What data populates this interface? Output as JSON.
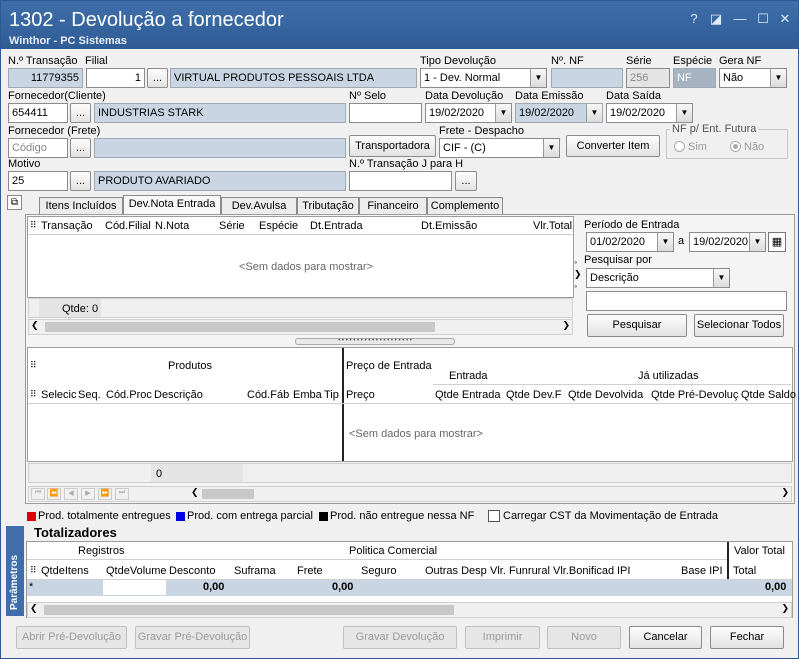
{
  "window": {
    "title": "1302 - Devolução a fornecedor",
    "subtitle": "Winthor - PC Sistemas"
  },
  "header": {
    "labels": {
      "transacao": "N.º Transação",
      "filial": "Filial",
      "tipo_devolucao": "Tipo Devolução",
      "num_nf": "Nº. NF",
      "serie": "Série",
      "especie": "Espécie",
      "gera_nf": "Gera NF",
      "fornecedor_cliente": "Fornecedor(Cliente)",
      "num_selo": "Nº Selo",
      "data_devolucao": "Data Devolução",
      "data_emissao": "Data Emissão",
      "data_saida": "Data Saída",
      "fornecedor_frete": "Fornecedor (Frete)",
      "frete_despacho": "Frete - Despacho",
      "nf_futura": "NF p/ Ent. Futura",
      "motivo": "Motivo",
      "transacao_j": "N.º Transação J para H"
    },
    "values": {
      "transacao": "11779355",
      "filial": "1",
      "filial_nome": "VIRTUAL PRODUTOS PESSOAIS LTDA",
      "tipo_devolucao": "1 - Dev. Normal",
      "num_nf": "",
      "serie": "256",
      "especie": "NF",
      "gera_nf": "Não",
      "fornecedor_codigo": "654411",
      "fornecedor_nome": "INDUSTRIAS STARK",
      "num_selo": "",
      "data_devolucao": "19/02/2020",
      "data_emissao": "19/02/2020",
      "data_saida": "19/02/2020",
      "fornecedor_frete_placeholder": "Código",
      "frete_despacho": "CIF - (C)",
      "radio_sim": "Sim",
      "radio_nao": "Não",
      "motivo_codigo": "25",
      "motivo_nome": "PRODUTO AVARIADO",
      "transacao_j": ""
    },
    "buttons": {
      "ellipsis": "...",
      "transportadora": "Transportadora",
      "converter_item": "Converter Item"
    }
  },
  "tabs": [
    {
      "label": "Itens Incluídos"
    },
    {
      "label": "Dev.Nota Entrada"
    },
    {
      "label": "Dev.Avulsa"
    },
    {
      "label": "Tributação"
    },
    {
      "label": "Financeiro"
    },
    {
      "label": "Complemento"
    }
  ],
  "notes_grid": {
    "columns": [
      "Transação",
      "Cód.Filial",
      "N.Nota",
      "Série",
      "Espécie",
      "Dt.Entrada",
      "Dt.Emissão",
      "Vlr.Total"
    ],
    "empty_text": "<Sem dados para mostrar>",
    "qtde_label": "Qtde: 0"
  },
  "search_panel": {
    "periodo_label": "Período de Entrada",
    "data_inicio": "01/02/2020",
    "a_label": "a",
    "data_fim": "19/02/2020",
    "pesquisar_por_label": "Pesquisar por",
    "pesquisar_por_value": "Descrição",
    "search_text": "",
    "pesquisar_button": "Pesquisar",
    "selecionar_todos_button": "Selecionar Todos"
  },
  "products_grid": {
    "group_headers": {
      "produtos": "Produtos",
      "preco_entrada": "Preço de Entrada",
      "entrada": "Entrada",
      "ja_utilizadas": "Já utilizadas"
    },
    "columns": [
      "Selecic",
      "Seq.",
      "Cód.Proc",
      "Descrição",
      "Cód.Fáb",
      "Emba",
      "Tip",
      "Preço",
      "Qtde Entrada",
      "Qtde Dev.F",
      "Qtde Devolvida",
      "Qtde Pré-Devoluç",
      "Qtde Saldo"
    ],
    "empty_text": "<Sem dados para mostrar>",
    "footer_count": "0"
  },
  "legend": {
    "items": [
      {
        "color": "#e00000",
        "label": "Prod. totalmente entregues"
      },
      {
        "color": "#0000e0",
        "label": "Prod. com entrega parcial"
      },
      {
        "color": "#000000",
        "label": "Prod. não entregue nessa NF"
      }
    ],
    "checkbox_label": "Carregar CST da Movimentação de Entrada"
  },
  "totalizadores": {
    "title": "Totalizadores",
    "side_label": "Parâmetros",
    "group_headers": {
      "registros": "Registros",
      "politica": "Politica Comercial",
      "valor_total": "Valor Total"
    },
    "columns": [
      "QtdeItens",
      "QtdeVolume",
      "Desconto",
      "Suframa",
      "Frete",
      "Seguro",
      "Outras Desp",
      "Vlr. Funrural",
      "Vlr.Bonificad",
      "IPI",
      "Base IPI",
      "Total"
    ],
    "row_marker": "*",
    "values": {
      "desconto": "0,00",
      "frete": "0,00",
      "total": "0,00"
    }
  },
  "footer_buttons": {
    "abrir_pre": "Abrir Pré-Devolução",
    "gravar_pre": "Gravar Pré-Devolução",
    "gravar": "Gravar Devolução",
    "imprimir": "Imprimir",
    "novo": "Novo",
    "cancelar": "Cancelar",
    "fechar": "Fechar"
  },
  "colors": {
    "title_bar": "#3f6eaa",
    "readonly_field": "#c9d5e2"
  }
}
